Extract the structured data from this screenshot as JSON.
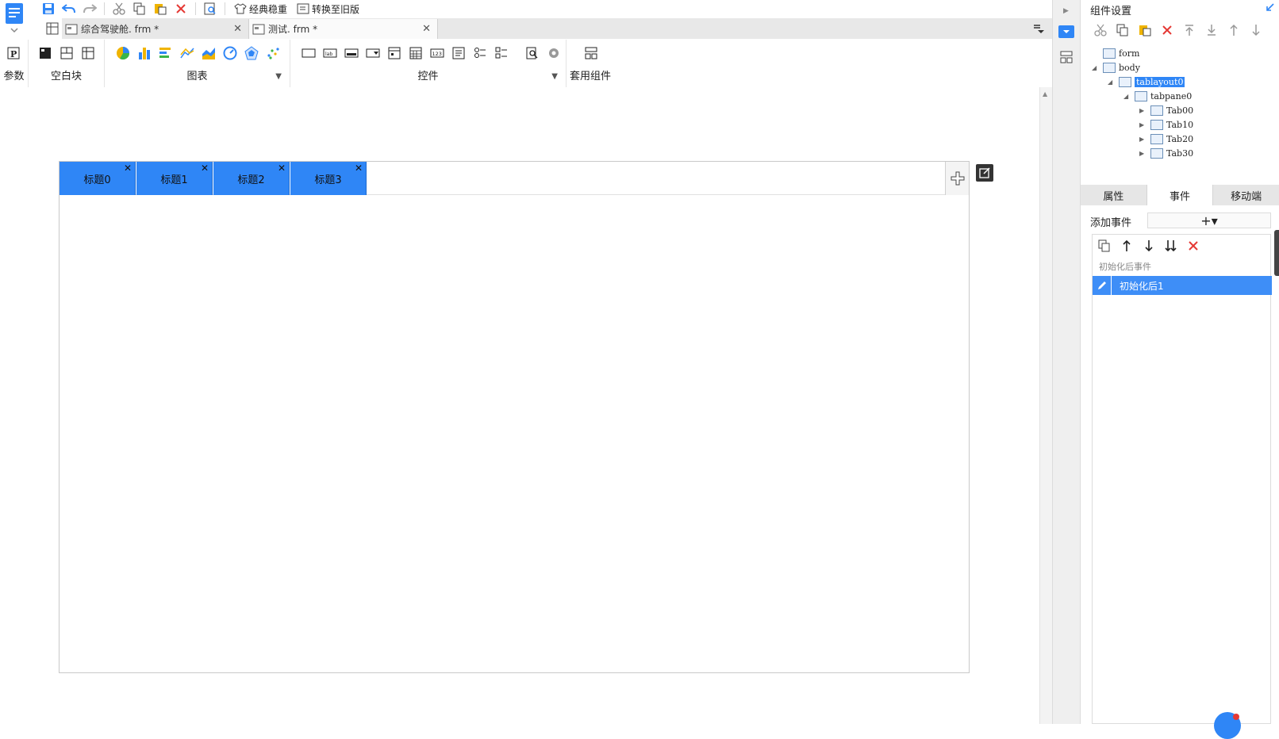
{
  "toolbar": {
    "classic_label": "经典稳重",
    "convert_label": "转换至旧版"
  },
  "file_tabs": [
    {
      "title": "综合驾驶舱. frm *"
    },
    {
      "title": "测试. frm *"
    }
  ],
  "ribbon": {
    "params_label": "参数",
    "blank_label": "空白块",
    "charts_label": "图表",
    "controls_label": "控件",
    "template_label": "套用组件"
  },
  "tab_layout": {
    "tabs": [
      {
        "label": "标题0"
      },
      {
        "label": "标题1"
      },
      {
        "label": "标题2"
      },
      {
        "label": "标题3"
      }
    ]
  },
  "right_panel": {
    "title": "组件设置",
    "tree": [
      {
        "label": "form",
        "icon": "form-icon"
      },
      {
        "label": "body",
        "icon": "body-icon"
      },
      {
        "label": "tablayout0",
        "icon": "tablayout-icon",
        "selected": true
      },
      {
        "label": "tabpane0",
        "icon": "tabpane-icon"
      },
      {
        "label": "Tab00",
        "icon": "tab-icon"
      },
      {
        "label": "Tab10",
        "icon": "tab-icon"
      },
      {
        "label": "Tab20",
        "icon": "tab-icon"
      },
      {
        "label": "Tab30",
        "icon": "tab-icon"
      }
    ],
    "tabs": [
      {
        "label": "属性"
      },
      {
        "label": "事件"
      },
      {
        "label": "移动端"
      }
    ],
    "add_event_label": "添加事件",
    "add_event_symbol": "+▾",
    "event_group": "初始化后事件",
    "event_item": "初始化后1"
  },
  "colors": {
    "accent": "#2f86f6",
    "delete": "#e53935"
  }
}
